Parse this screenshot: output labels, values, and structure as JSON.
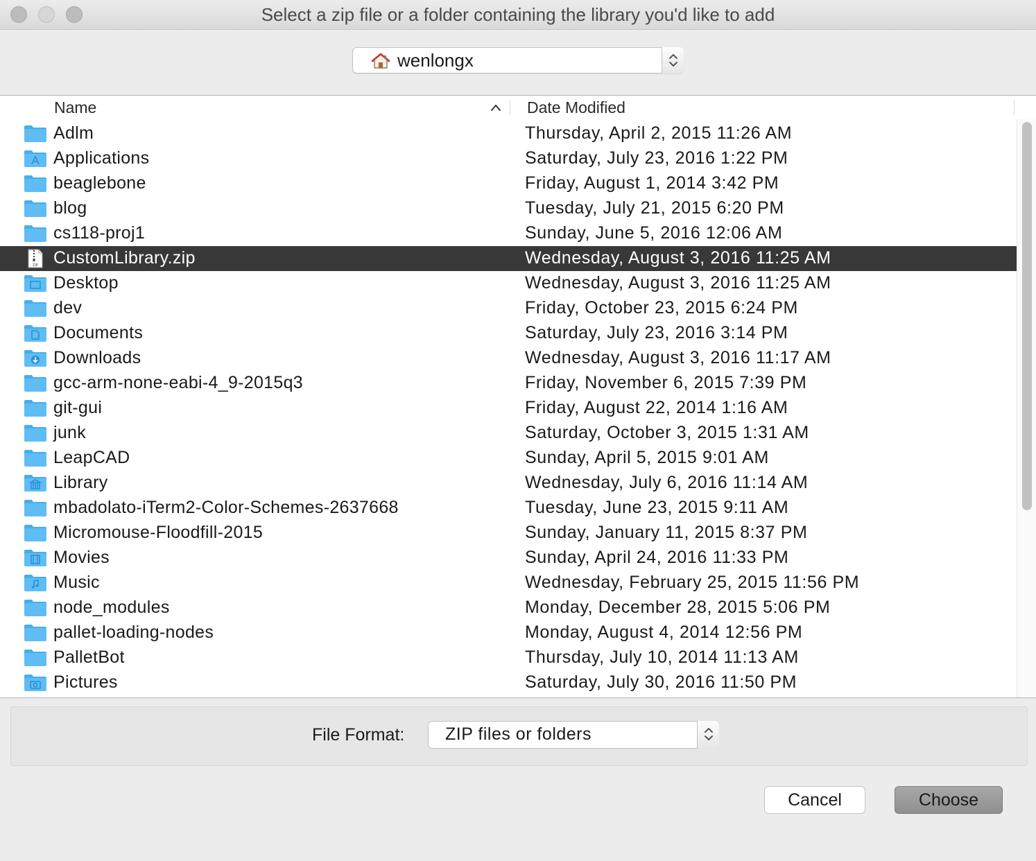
{
  "window": {
    "title": "Select a zip file or a folder containing the library you'd like to add"
  },
  "location": {
    "label": "wenlongx",
    "icon": "home-icon"
  },
  "columns": {
    "name": "Name",
    "date_modified": "Date Modified",
    "sort": "ascending"
  },
  "files": [
    {
      "name": "Adlm",
      "date": "Thursday, April 2, 2015 11:26 AM",
      "icon": "folder"
    },
    {
      "name": "Applications",
      "date": "Saturday, July 23, 2016 1:22 PM",
      "icon": "applications-folder"
    },
    {
      "name": "beaglebone",
      "date": "Friday, August 1, 2014 3:42 PM",
      "icon": "folder"
    },
    {
      "name": "blog",
      "date": "Tuesday, July 21, 2015 6:20 PM",
      "icon": "folder"
    },
    {
      "name": "cs118-proj1",
      "date": "Sunday, June 5, 2016 12:06 AM",
      "icon": "folder"
    },
    {
      "name": "CustomLibrary.zip",
      "date": "Wednesday, August 3, 2016 11:25 AM",
      "icon": "zip-file",
      "selected": true
    },
    {
      "name": "Desktop",
      "date": "Wednesday, August 3, 2016 11:25 AM",
      "icon": "desktop-folder"
    },
    {
      "name": "dev",
      "date": "Friday, October 23, 2015 6:24 PM",
      "icon": "folder"
    },
    {
      "name": "Documents",
      "date": "Saturday, July 23, 2016 3:14 PM",
      "icon": "documents-folder"
    },
    {
      "name": "Downloads",
      "date": "Wednesday, August 3, 2016 11:17 AM",
      "icon": "downloads-folder"
    },
    {
      "name": "gcc-arm-none-eabi-4_9-2015q3",
      "date": "Friday, November 6, 2015 7:39 PM",
      "icon": "folder"
    },
    {
      "name": "git-gui",
      "date": "Friday, August 22, 2014 1:16 AM",
      "icon": "folder"
    },
    {
      "name": "junk",
      "date": "Saturday, October 3, 2015 1:31 AM",
      "icon": "folder"
    },
    {
      "name": "LeapCAD",
      "date": "Sunday, April 5, 2015 9:01 AM",
      "icon": "folder"
    },
    {
      "name": "Library",
      "date": "Wednesday, July 6, 2016 11:14 AM",
      "icon": "library-folder"
    },
    {
      "name": "mbadolato-iTerm2-Color-Schemes-2637668",
      "date": "Tuesday, June 23, 2015 9:11 AM",
      "icon": "folder"
    },
    {
      "name": "Micromouse-Floodfill-2015",
      "date": "Sunday, January 11, 2015 8:37 PM",
      "icon": "folder"
    },
    {
      "name": "Movies",
      "date": "Sunday, April 24, 2016 11:33 PM",
      "icon": "movies-folder"
    },
    {
      "name": "Music",
      "date": "Wednesday, February 25, 2015 11:56 PM",
      "icon": "music-folder"
    },
    {
      "name": "node_modules",
      "date": "Monday, December 28, 2015 5:06 PM",
      "icon": "folder"
    },
    {
      "name": "pallet-loading-nodes",
      "date": "Monday, August 4, 2014 12:56 PM",
      "icon": "folder"
    },
    {
      "name": "PalletBot",
      "date": "Thursday, July 10, 2014 11:13 AM",
      "icon": "folder"
    },
    {
      "name": "Pictures",
      "date": "Saturday, July 30, 2016 11:50 PM",
      "icon": "pictures-folder"
    }
  ],
  "format": {
    "label": "File Format:",
    "value": "ZIP files or folders"
  },
  "buttons": {
    "cancel": "Cancel",
    "choose": "Choose"
  },
  "colors": {
    "folder": "#5fbdf4",
    "folder_tab": "#47aeea",
    "selection": "#383838",
    "default_button": "#9a9a9a"
  }
}
